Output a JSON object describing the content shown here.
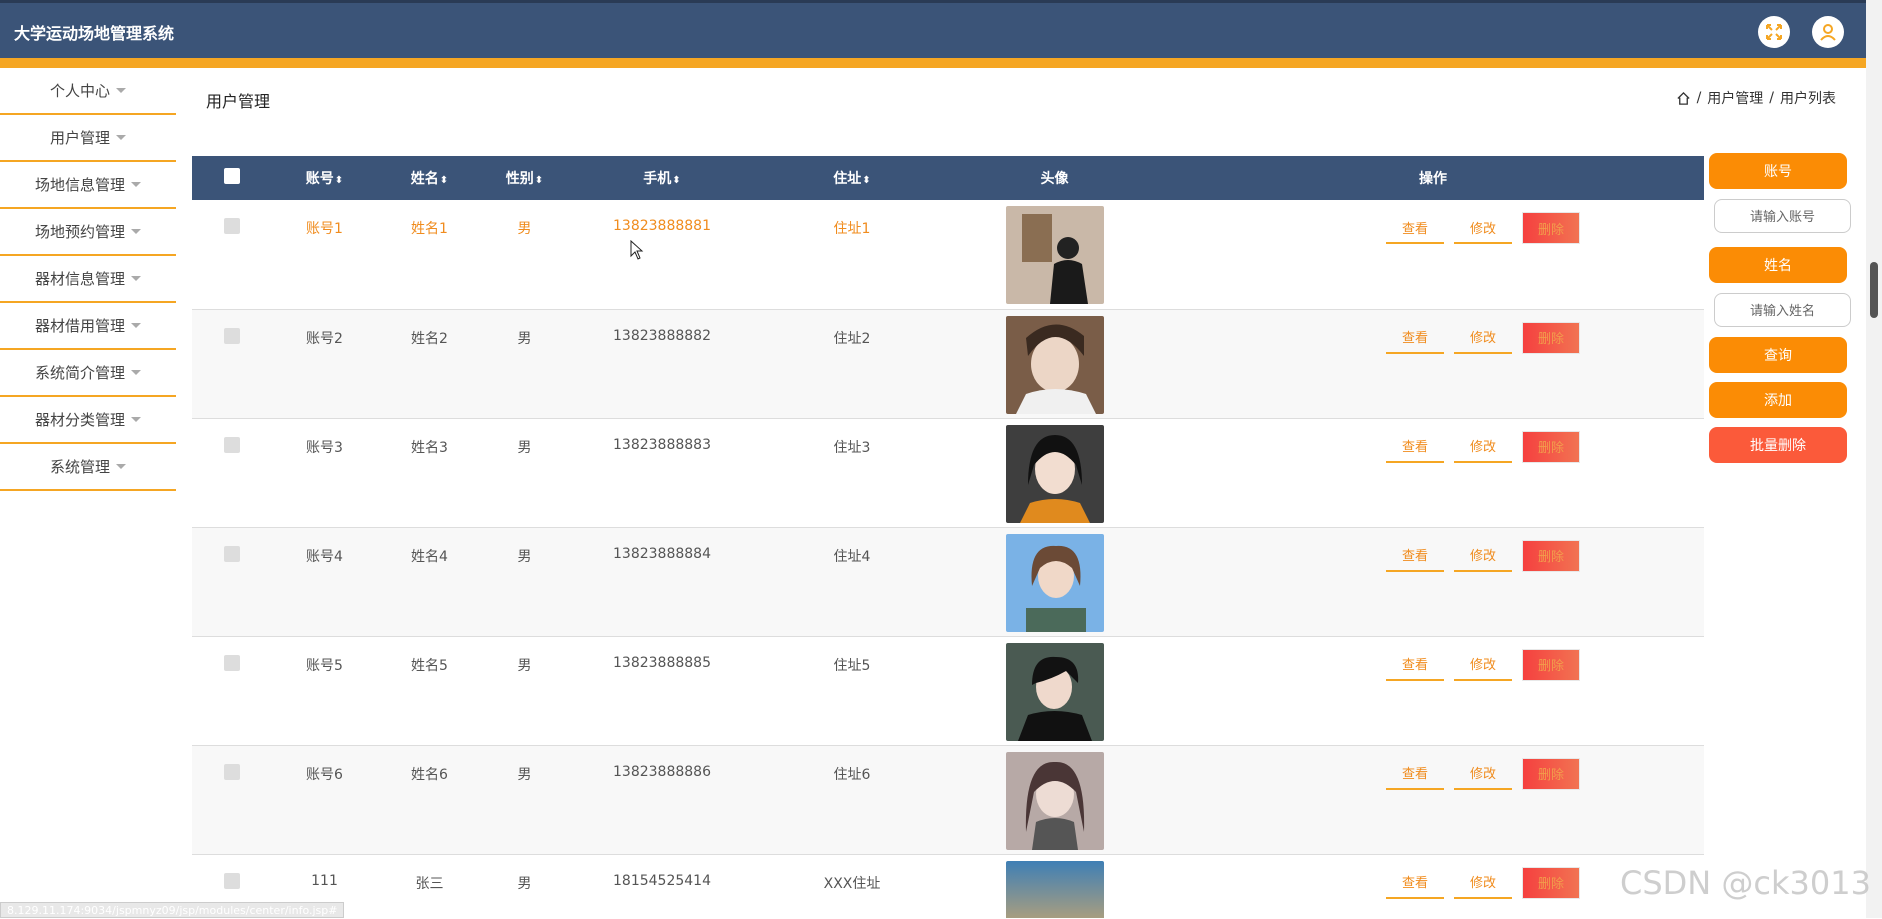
{
  "app": {
    "title": "大学运动场地管理系统"
  },
  "header": {
    "icons": [
      "fullscreen-icon",
      "user-icon"
    ],
    "accent_color": "#f5a623",
    "bar_color": "#3b5478"
  },
  "sidebar": {
    "items": [
      {
        "label": "个人中心"
      },
      {
        "label": "用户管理"
      },
      {
        "label": "场地信息管理"
      },
      {
        "label": "场地预约管理"
      },
      {
        "label": "器材信息管理"
      },
      {
        "label": "器材借用管理"
      },
      {
        "label": "系统简介管理"
      },
      {
        "label": "器材分类管理"
      },
      {
        "label": "系统管理"
      }
    ]
  },
  "page": {
    "title": "用户管理",
    "breadcrumb": [
      "用户管理",
      "用户列表"
    ],
    "breadcrumb_sep": "/"
  },
  "table": {
    "columns": [
      "账号",
      "姓名",
      "性别",
      "手机",
      "住址",
      "头像",
      "操作"
    ],
    "sort_glyph": "⬍",
    "rows": [
      {
        "account": "账号1",
        "name": "姓名1",
        "gender": "男",
        "phone": "13823888881",
        "address": "住址1"
      },
      {
        "account": "账号2",
        "name": "姓名2",
        "gender": "男",
        "phone": "13823888882",
        "address": "住址2"
      },
      {
        "account": "账号3",
        "name": "姓名3",
        "gender": "男",
        "phone": "13823888883",
        "address": "住址3"
      },
      {
        "account": "账号4",
        "name": "姓名4",
        "gender": "男",
        "phone": "13823888884",
        "address": "住址4"
      },
      {
        "account": "账号5",
        "name": "姓名5",
        "gender": "男",
        "phone": "13823888885",
        "address": "住址5"
      },
      {
        "account": "账号6",
        "name": "姓名6",
        "gender": "男",
        "phone": "13823888886",
        "address": "住址6"
      },
      {
        "account": "111",
        "name": "张三",
        "gender": "男",
        "phone": "18154525414",
        "address": "XXX住址"
      }
    ],
    "actions": {
      "view": "查看",
      "edit": "修改",
      "delete": "删除"
    }
  },
  "search_panel": {
    "account_label": "账号",
    "account_placeholder": "请输入账号",
    "name_label": "姓名",
    "name_placeholder": "请输入姓名",
    "query_button": "查询",
    "add_button": "添加",
    "batch_delete_button": "批量删除"
  },
  "status_url": "8.129.11.174:9034/jspmnyz09/jsp/modules/center/info.jsp#",
  "watermark": "CSDN @ck3013"
}
